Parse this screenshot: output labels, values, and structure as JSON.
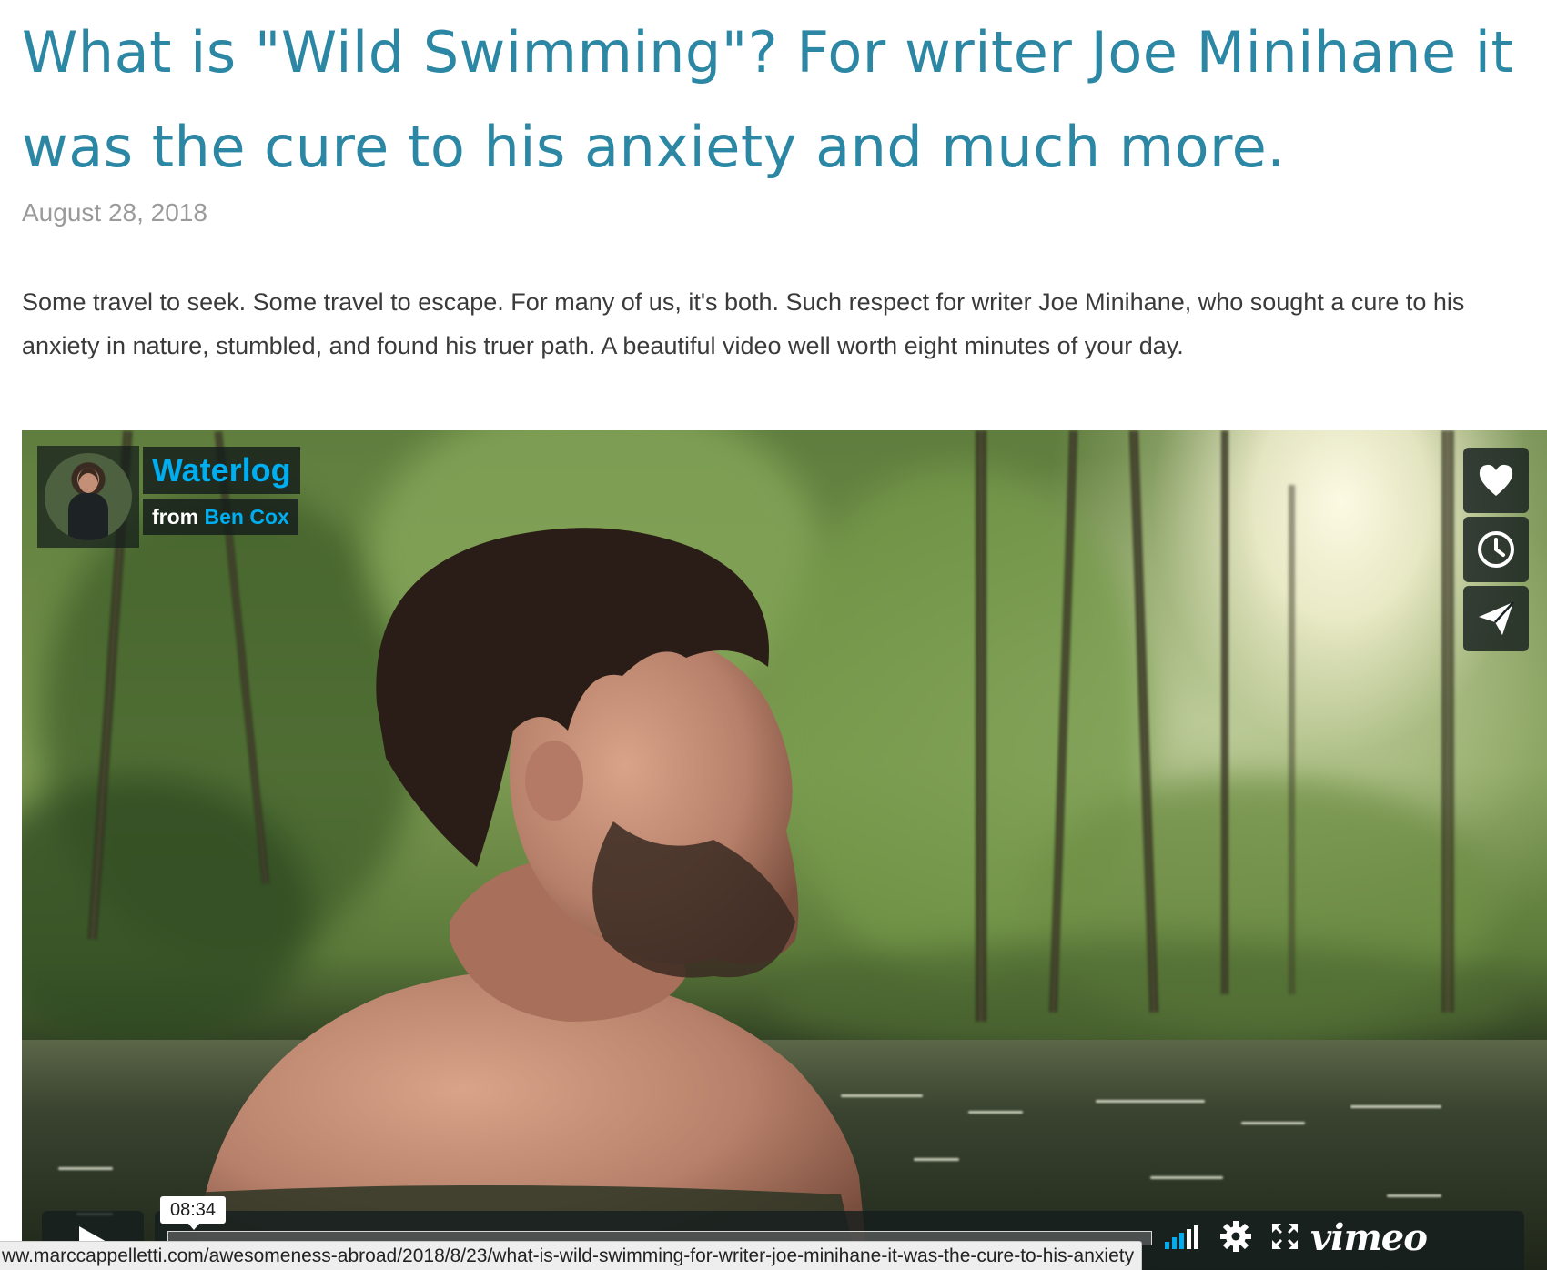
{
  "post": {
    "title": "What is \"Wild Swimming\"? For writer Joe Minihane it was the cure to his anxiety and much more.",
    "date": "August 28, 2018",
    "body": "Some travel to seek. Some travel to escape. For many of us, it's both. Such respect for writer Joe Minihane, who sought a cure to his anxiety in nature, stumbled, and found his truer path. A beautiful video well worth eight minutes of your day."
  },
  "video": {
    "title": "Waterlog",
    "from_label": "from",
    "author": "Ben Cox",
    "duration": "08:34",
    "progress": 0,
    "brand": "vimeo",
    "accent_color": "#00adef",
    "side_actions": [
      {
        "name": "like",
        "icon": "heart-icon"
      },
      {
        "name": "watch-later",
        "icon": "clock-icon"
      },
      {
        "name": "share",
        "icon": "paper-plane-icon"
      }
    ],
    "controls": {
      "play_icon": "play-icon",
      "volume_icon": "volume-bars-icon",
      "settings_icon": "gear-icon",
      "fullscreen_icon": "fullscreen-icon"
    }
  },
  "status_bar": {
    "url": "ww.marccappelletti.com/awesomeness-abroad/2018/8/23/what-is-wild-swimming-for-writer-joe-minihane-it-was-the-cure-to-his-anxiety"
  },
  "colors": {
    "title": "#2c87a4",
    "date": "#9a9a9a",
    "body": "#3a3a3a"
  }
}
